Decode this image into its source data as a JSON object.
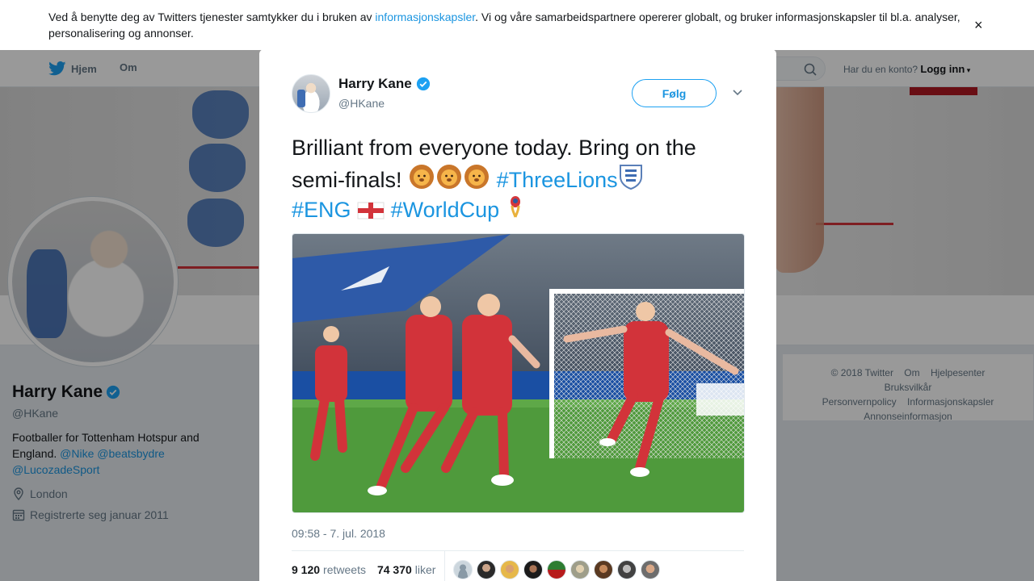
{
  "cookie": {
    "text_before": "Ved å benytte deg av Twitters tjenester samtykker du i bruken av ",
    "link": "informasjonskapsler",
    "text_after": ". Vi og våre samarbeidspartnere opererer globalt, og bruker informasjonskapsler til bl.a. analyser, personalisering og annonser.",
    "close": "×"
  },
  "nav": {
    "home": "Hjem",
    "about": "Om",
    "account_prompt": "Har du en konto?",
    "login": "Logg inn"
  },
  "profile": {
    "name": "Harry Kane",
    "handle": "@HKane",
    "bio_text": "Footballer for Tottenham Hotspur and England.",
    "bio_links": [
      "@Nike",
      "@beatsbydre",
      "@LucozadeSport"
    ],
    "location": "London",
    "joined": "Registrerte seg januar 2011"
  },
  "footer": {
    "links": [
      "© 2018 Twitter",
      "Om",
      "Hjelpesenter",
      "Bruksvilkår",
      "Personvernpolicy",
      "Informasjonskapsler",
      "Annonseinformasjon"
    ]
  },
  "tweet": {
    "author_name": "Harry Kane",
    "author_handle": "@HKane",
    "follow_label": "Følg",
    "text_line1": "Brilliant from everyone today. Bring on the",
    "text_line2_start": "semi-finals!",
    "hashtag_threelions": "#ThreeLions",
    "hashtag_eng": "#ENG",
    "hashtag_worldcup": "#WorldCup",
    "timestamp": "09:58 - 7. jul. 2018",
    "retweets_count": "9 120",
    "retweets_label": "retweets",
    "likes_count": "74 370",
    "likes_label": "liker"
  },
  "colors": {
    "accent": "#1da1f2",
    "link": "#1b95e0",
    "verified": "#1da1f2",
    "england_red": "#d2333a"
  }
}
